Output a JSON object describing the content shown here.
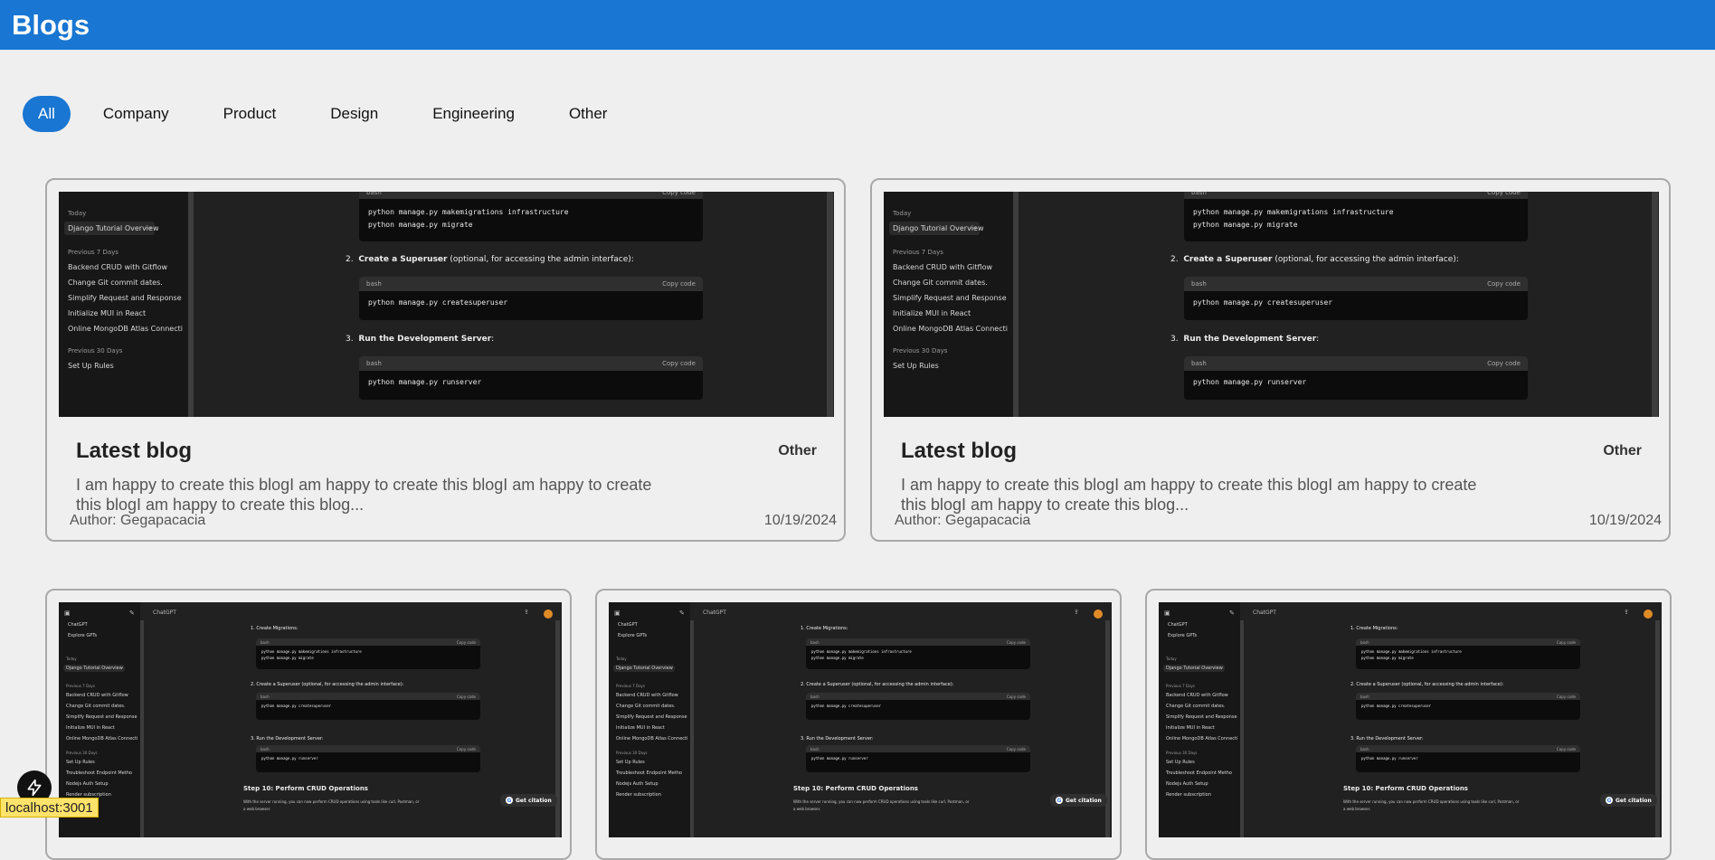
{
  "header": {
    "title": "Blogs"
  },
  "filters": [
    "All",
    "Company",
    "Product",
    "Design",
    "Engineering",
    "Other"
  ],
  "active_filter": "All",
  "featured_posts": [
    {
      "title": "Latest blog",
      "category": "Other",
      "excerpt": "I am happy to create this blogI am happy to create this blogI am happy to create this blogI am happy to create this blog...",
      "author": "Author: Gegapacacia",
      "date": "10/19/2024"
    },
    {
      "title": "Latest blog",
      "category": "Other",
      "excerpt": "I am happy to create this blogI am happy to create this blogI am happy to create this blogI am happy to create this blog...",
      "author": "Author: Gegapacacia",
      "date": "10/19/2024"
    }
  ],
  "thumbnail_big": {
    "side_today": "Today",
    "side_selected": "Django Tutorial Overview",
    "side_prev7": "Previous 7 Days",
    "side_items": [
      "Backend CRUD with Gitflow",
      "Change Git commit dates.",
      "Simplify Request and Response",
      "Initialize MUI in React",
      "Online MongoDB Atlas Connecti"
    ],
    "side_prev30": "Previous 30 Days",
    "side_last": "Set Up Rules",
    "bash": "bash",
    "copy": "Copy code",
    "code1a": "python manage.py makemigrations infrastructure",
    "code1b": "python manage.py migrate",
    "step2_num": "2.",
    "step2_bold": "Create a Superuser",
    "step2_rest": "(optional, for accessing the admin interface):",
    "code2": "python manage.py createsuperuser",
    "step3_num": "3.",
    "step3_bold": "Run the Development Server",
    "step3_rest": ":",
    "code3": "python manage.py runserver"
  },
  "thumbnail_small": {
    "app": "ChatGPT",
    "menu_a": "ChatGPT",
    "menu_b": "Explore GPTs",
    "side_today": "Today",
    "side_selected": "Django Tutorial Overview",
    "side_prev7": "Previous 7 Days",
    "side_items": [
      "Backend CRUD with Gitflow",
      "Change Git commit dates.",
      "Simplify Request and Response",
      "Initialize MUI in React",
      "Online MongoDB Atlas Connecti"
    ],
    "side_prev30": "Previous 30 Days",
    "side_items2": [
      "Set Up Rules",
      "Troubleshoot Endpoint Metho",
      "Nodejs Auth Setup",
      "Render subscription"
    ],
    "step1": "1.  Create Migrations:",
    "step2": "2.  Create a Superuser (optional, for accessing the admin interface):",
    "step3": "3.  Run the Development Server:",
    "step10": "Step 10: Perform CRUD Operations",
    "body": "With the server running, you can now perform CRUD operations using tools like curl, Postman, or",
    "body2": "a web browser.",
    "citation": "Get citation",
    "code1a": "python manage.py makemigrations infrastructure",
    "code1b": "python manage.py migrate",
    "code2": "python manage.py createsuperuser",
    "code3": "python manage.py runserver",
    "bash": "bash",
    "copy": "Copy code"
  },
  "dev": {
    "host": "localhost:3001"
  }
}
